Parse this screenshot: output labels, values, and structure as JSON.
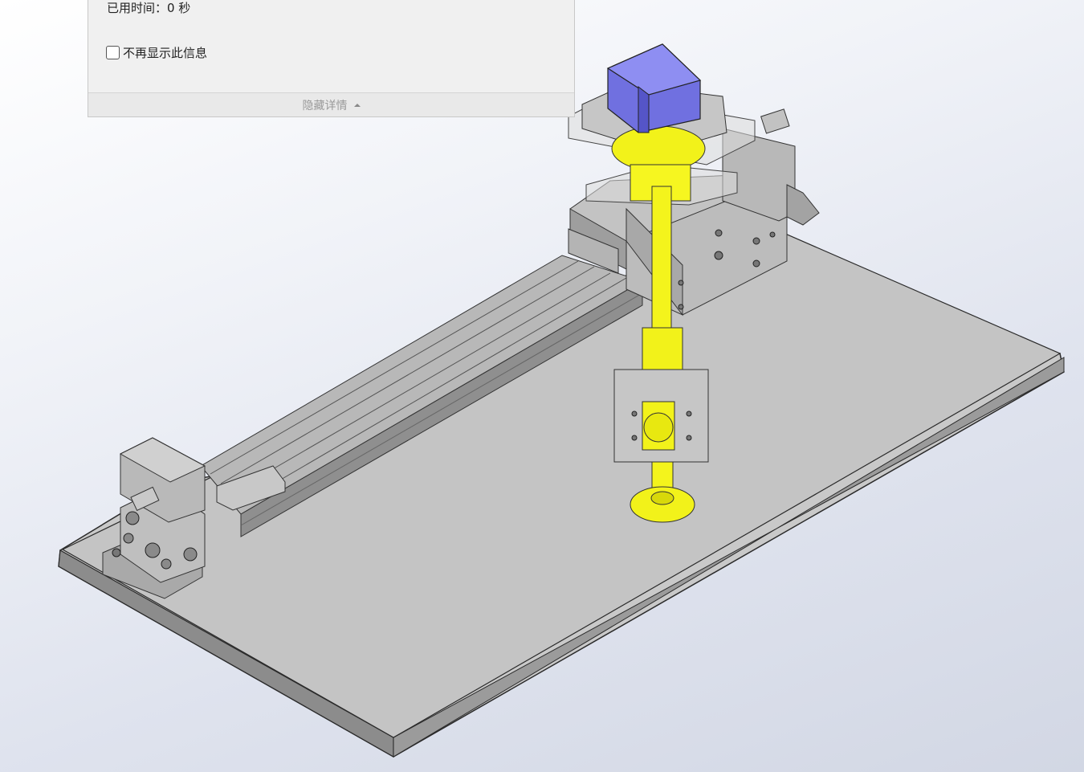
{
  "dialog": {
    "elapsed_text": "已用时间：0 秒",
    "no_show_label": "不再显示此信息",
    "no_show_checked": false,
    "details_toggle_label": "隐藏详情",
    "details_toggle_icon": "caret-up-icon"
  },
  "model_view": {
    "colors": {
      "base_plate": "#c7c7c7",
      "rail": "#b4b4b4",
      "carriage": "#bdbdbd",
      "shaft": "#f5f50a",
      "top_block": "#7878e6"
    }
  }
}
